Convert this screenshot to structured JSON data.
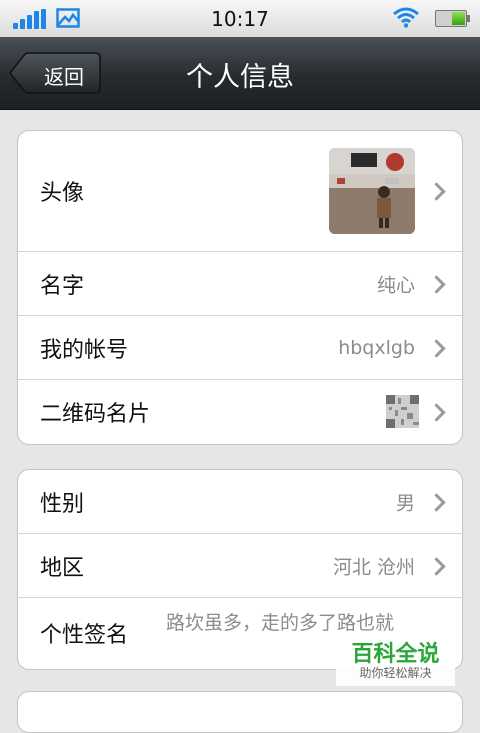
{
  "status_bar": {
    "time": "10:17",
    "signal_icon": "signal-bars-icon",
    "picture_icon": "image-icon",
    "wifi_icon": "wifi-icon",
    "battery_icon": "battery-icon"
  },
  "nav": {
    "back_label": "返回",
    "title": "个人信息"
  },
  "profile": {
    "avatar_label": "头像",
    "name_label": "名字",
    "name_value": "纯心",
    "account_label": "我的帐号",
    "account_value": "hbqxlgb",
    "qrcode_label": "二维码名片",
    "qrcode_icon": "qr-code-icon"
  },
  "details": {
    "gender_label": "性别",
    "gender_value": "男",
    "region_label": "地区",
    "region_value": "河北 沧州",
    "signature_label": "个性签名",
    "signature_value": "路坎虽多，走的多了路也就"
  },
  "watermark": {
    "title": "百科全说",
    "subtitle": "助你轻松解决"
  },
  "colors": {
    "nav_bg": "#262b2f",
    "accent": "#1d86e6",
    "watermark": "#2aa63a"
  }
}
